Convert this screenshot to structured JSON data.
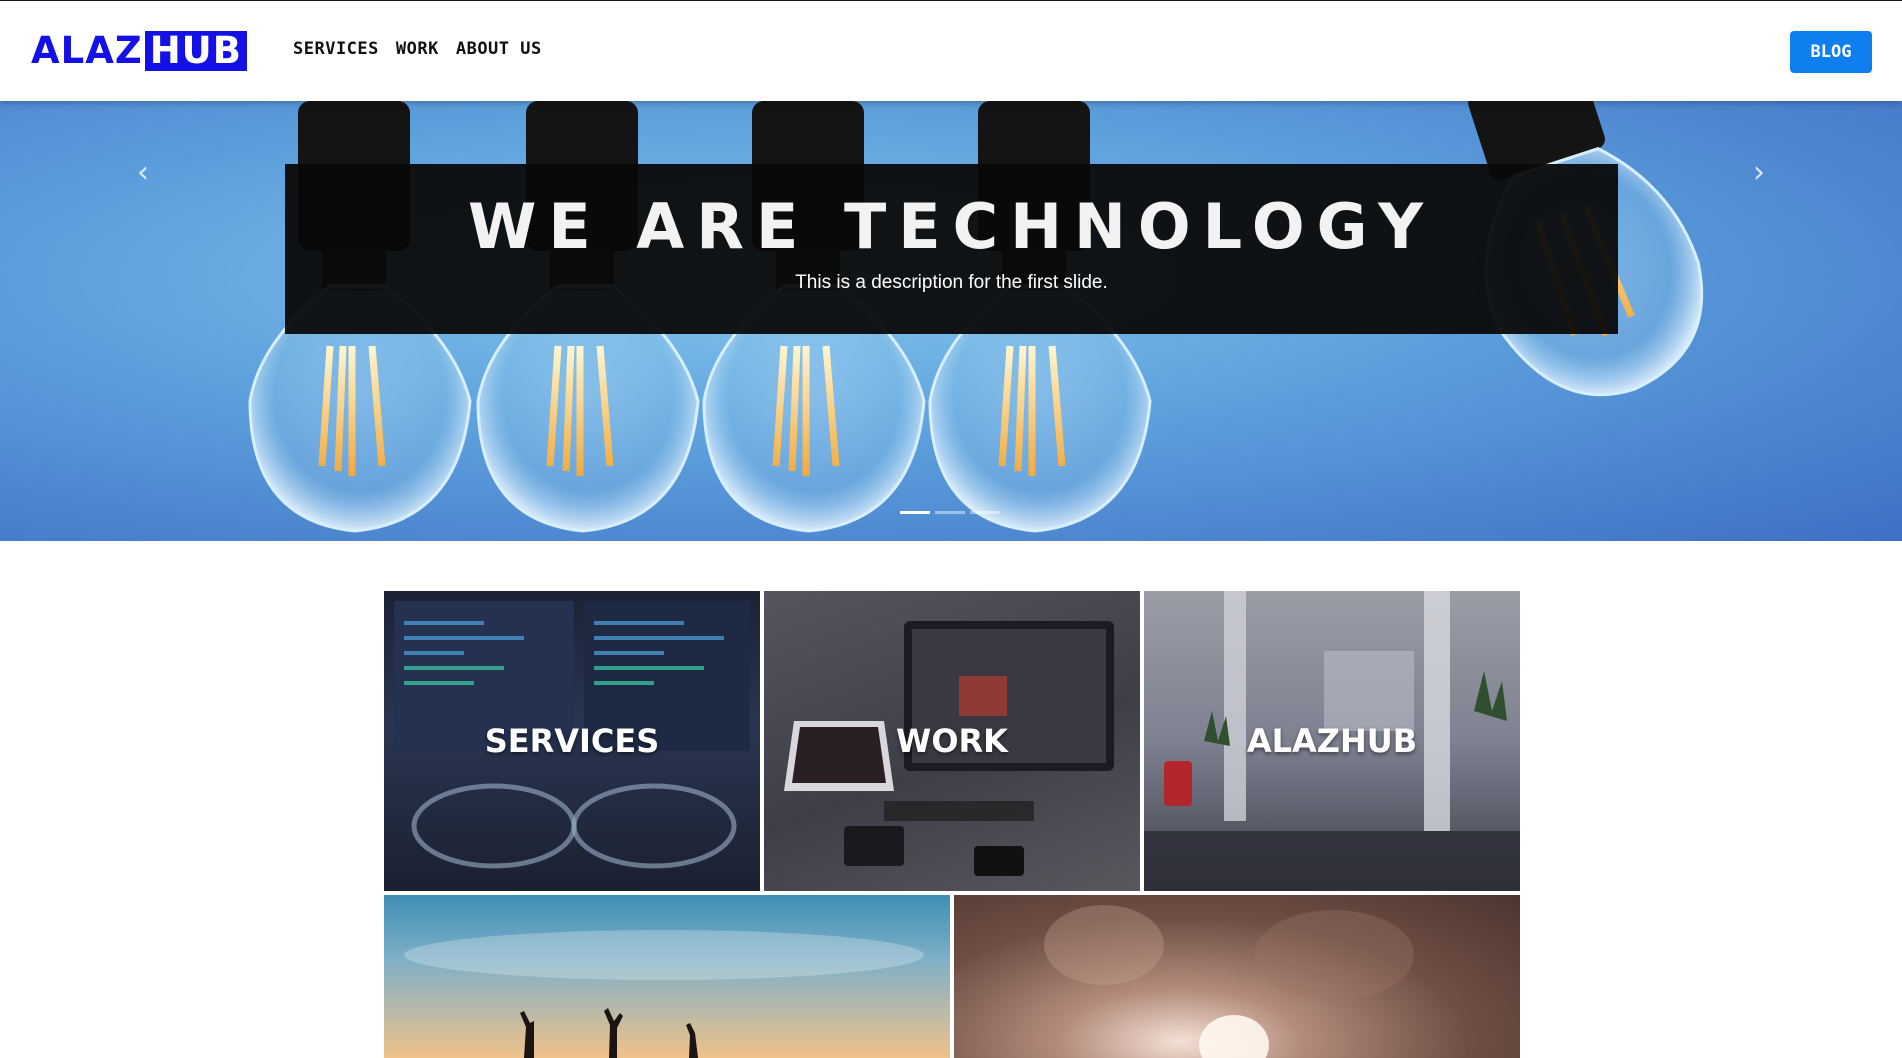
{
  "navbar": {
    "logo": {
      "part1": "ALAZ",
      "part2": "HUB"
    },
    "links": [
      "SERVICES",
      "WORK",
      "ABOUT US"
    ],
    "blog_label": "BLOG"
  },
  "hero": {
    "title": "WE ARE TECHNOLOGY",
    "description": "This is a description for the first slide.",
    "prev_icon": "chevron-left-icon",
    "next_icon": "chevron-right-icon",
    "slide_count": 3,
    "active_slide": 1
  },
  "tiles": {
    "services": "SERVICES",
    "work": "WORK",
    "alazhub": "ALAZHUB"
  },
  "colors": {
    "brand": "#1411e6",
    "blog_button": "#0f7ff0",
    "caption_bg": "#080808"
  }
}
